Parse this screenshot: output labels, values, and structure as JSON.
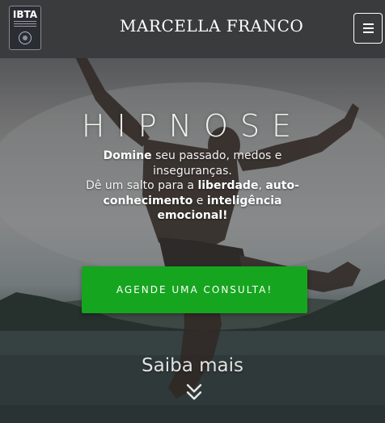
{
  "header": {
    "logo_text": "IBTA",
    "brand": "MARCELLA FRANCO",
    "menu_icon": "hamburger-icon"
  },
  "hero": {
    "headline": "HIPNOSE",
    "subtitle": {
      "p1": "Domine",
      "p2": " seu passado, medos e inseguranças.",
      "p3": "Dê um salto para a ",
      "p4": "liberdade",
      "p5": ", ",
      "p6": "auto-conhecimento",
      "p7": " e ",
      "p8": "inteligência emocional!"
    },
    "cta_label": "AGENDE UMA CONSULTA!",
    "more_label": "Saiba mais",
    "more_icon": "double-chevron-down-icon"
  },
  "colors": {
    "header_bg": "#3a3b3d",
    "cta_bg": "#16a51f",
    "text": "#ffffff"
  }
}
